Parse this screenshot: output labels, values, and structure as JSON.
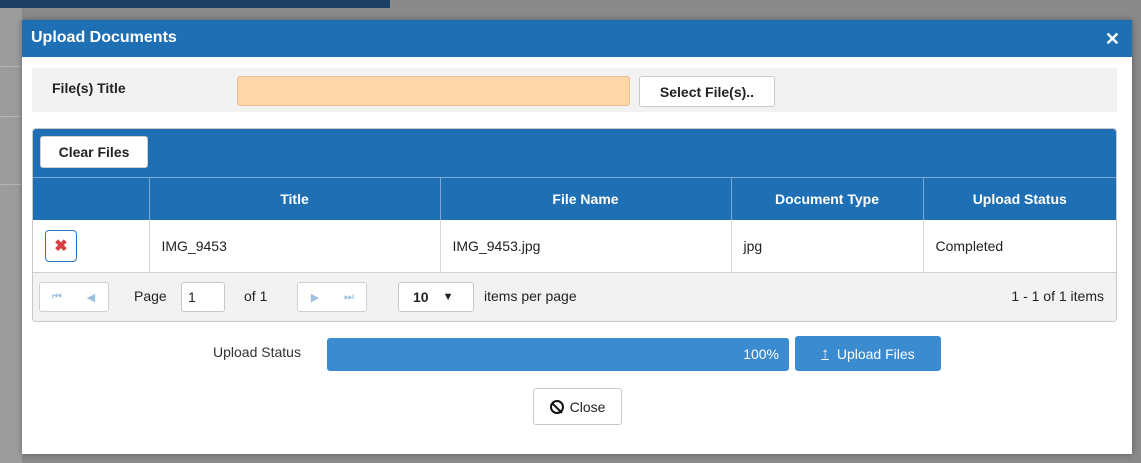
{
  "dialog": {
    "title": "Upload Documents",
    "close_symbol": "✕"
  },
  "file_title": {
    "label": "File(s) Title",
    "value": "",
    "placeholder": "",
    "select_button": "Select File(s).."
  },
  "grid": {
    "clear_button": "Clear Files",
    "columns": [
      "",
      "Title",
      "File Name",
      "Document Type",
      "Upload Status"
    ],
    "rows": [
      {
        "delete_symbol": "✖",
        "title": "IMG_9453",
        "file_name": "IMG_9453.jpg",
        "document_type": "jpg",
        "upload_status": "Completed"
      }
    ],
    "pager": {
      "first": "⏮",
      "prev": "◀",
      "next": "▶",
      "last": "⏭",
      "page_label": "Page",
      "page_value": "1",
      "of_label": "of 1",
      "page_size": "10",
      "page_size_caret": "▼",
      "items_per_page_label": "items per page",
      "info": "1 - 1 of 1 items"
    }
  },
  "upload": {
    "status_label": "Upload Status",
    "progress_fraction": 1.0,
    "progress_text": "100%",
    "upload_button": "Upload Files",
    "upload_icon": "upload-icon"
  },
  "close_button": "Close",
  "colors": {
    "header_blue": "#1f6fb5",
    "progress_blue": "#3b8bd0",
    "title_input_bg": "#ffd6a8",
    "delete_red": "#d64040"
  }
}
